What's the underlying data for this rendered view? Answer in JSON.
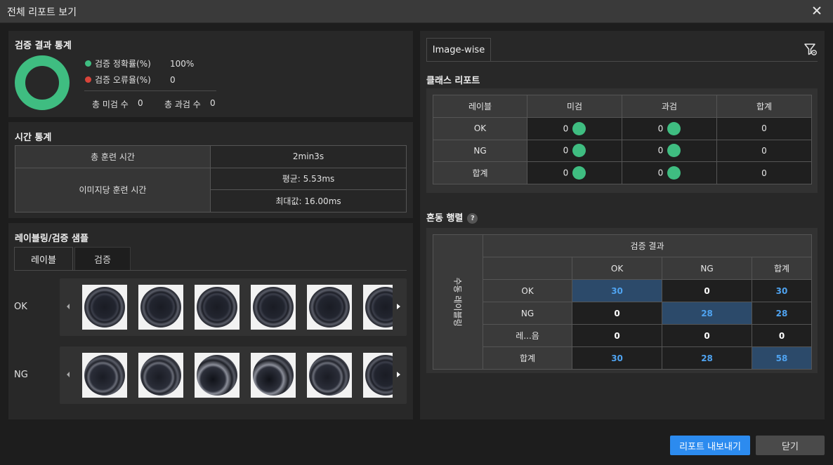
{
  "window": {
    "title": "전체 리포트 보기"
  },
  "stats": {
    "title": "검증 결과 통계",
    "accuracy_label": "검증 정확률(%)",
    "accuracy_value": "100%",
    "error_label": "검증 오류율(%)",
    "error_value": "0",
    "miss_label": "총 미검 수",
    "miss_value": "0",
    "over_label": "총 과검 수",
    "over_value": "0",
    "accuracy_color": "#3fbd81",
    "error_color": "#d9443a",
    "donut_accuracy_fraction": 1.0
  },
  "time": {
    "title": "시간 통계",
    "total_label": "총 훈련 시간",
    "total_value": "2min3s",
    "per_image_label": "이미지당 훈련 시간",
    "avg_value": "평균: 5.53ms",
    "max_value": "최대값: 16.00ms"
  },
  "samples": {
    "title": "레이블링/검증 샘플",
    "tabs": [
      "레이블",
      "검증"
    ],
    "rows": [
      {
        "label": "OK",
        "count": 6
      },
      {
        "label": "NG",
        "count": 6
      }
    ]
  },
  "right": {
    "tab": "Image-wise",
    "filter_icon": "filter-settings-icon",
    "class_report": {
      "title": "클래스 리포트",
      "headers": [
        "레이블",
        "미검",
        "과검",
        "합계"
      ],
      "rows": [
        {
          "label": "OK",
          "miss": "0",
          "over": "0",
          "total": "0"
        },
        {
          "label": "NG",
          "miss": "0",
          "over": "0",
          "total": "0"
        },
        {
          "label": "합계",
          "miss": "0",
          "over": "0",
          "total": "0"
        }
      ]
    },
    "confusion": {
      "title": "혼동 행렬",
      "help": "?",
      "col_group": "검증 결과",
      "row_group": "수동 레이블링",
      "cols": [
        "OK",
        "NG",
        "합계"
      ],
      "rows": [
        {
          "label": "OK",
          "values": [
            "30",
            "0",
            "30"
          ]
        },
        {
          "label": "NG",
          "values": [
            "0",
            "28",
            "28"
          ]
        },
        {
          "label": "레...음",
          "values": [
            "0",
            "0",
            "0"
          ]
        },
        {
          "label": "합계",
          "values": [
            "30",
            "28",
            "58"
          ]
        }
      ]
    }
  },
  "buttons": {
    "export": "리포트 내보내기",
    "close": "닫기"
  }
}
